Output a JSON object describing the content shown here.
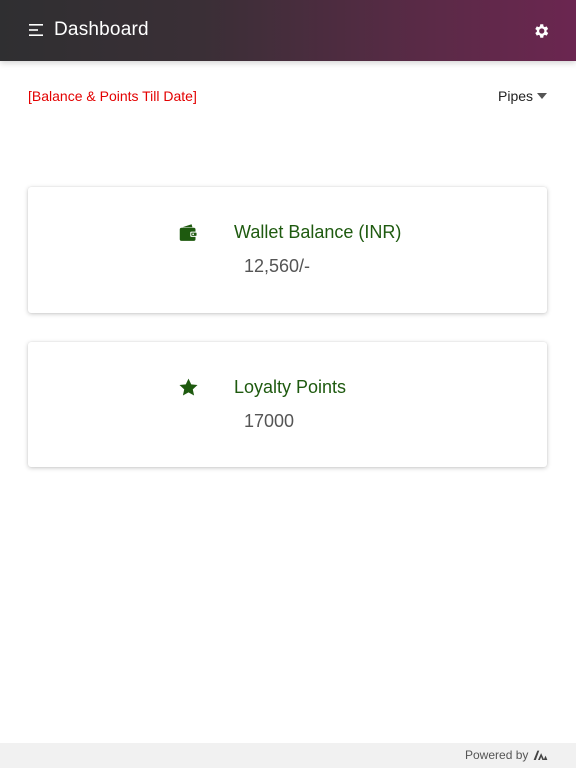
{
  "header": {
    "title": "Dashboard",
    "menu_icon": "hamburger-menu-icon",
    "settings_icon": "gear-icon",
    "gradient_start": "#2f2f31",
    "gradient_end": "#6b2650"
  },
  "subheader": {
    "label": "[Balance & Points Till Date]",
    "label_color": "#e30000",
    "dropdown": {
      "selected": "Pipes",
      "icon": "caret-down-icon"
    }
  },
  "cards": [
    {
      "title": "Wallet Balance (INR)",
      "value": "12,560/-",
      "icon": "wallet-icon"
    },
    {
      "title": "Loyalty Points",
      "value": "17000",
      "icon": "star-icon"
    }
  ],
  "accent_color": "#1e5a0f",
  "footer": {
    "powered_by": "Powered by",
    "logo_icon": "brand-logo-icon"
  }
}
